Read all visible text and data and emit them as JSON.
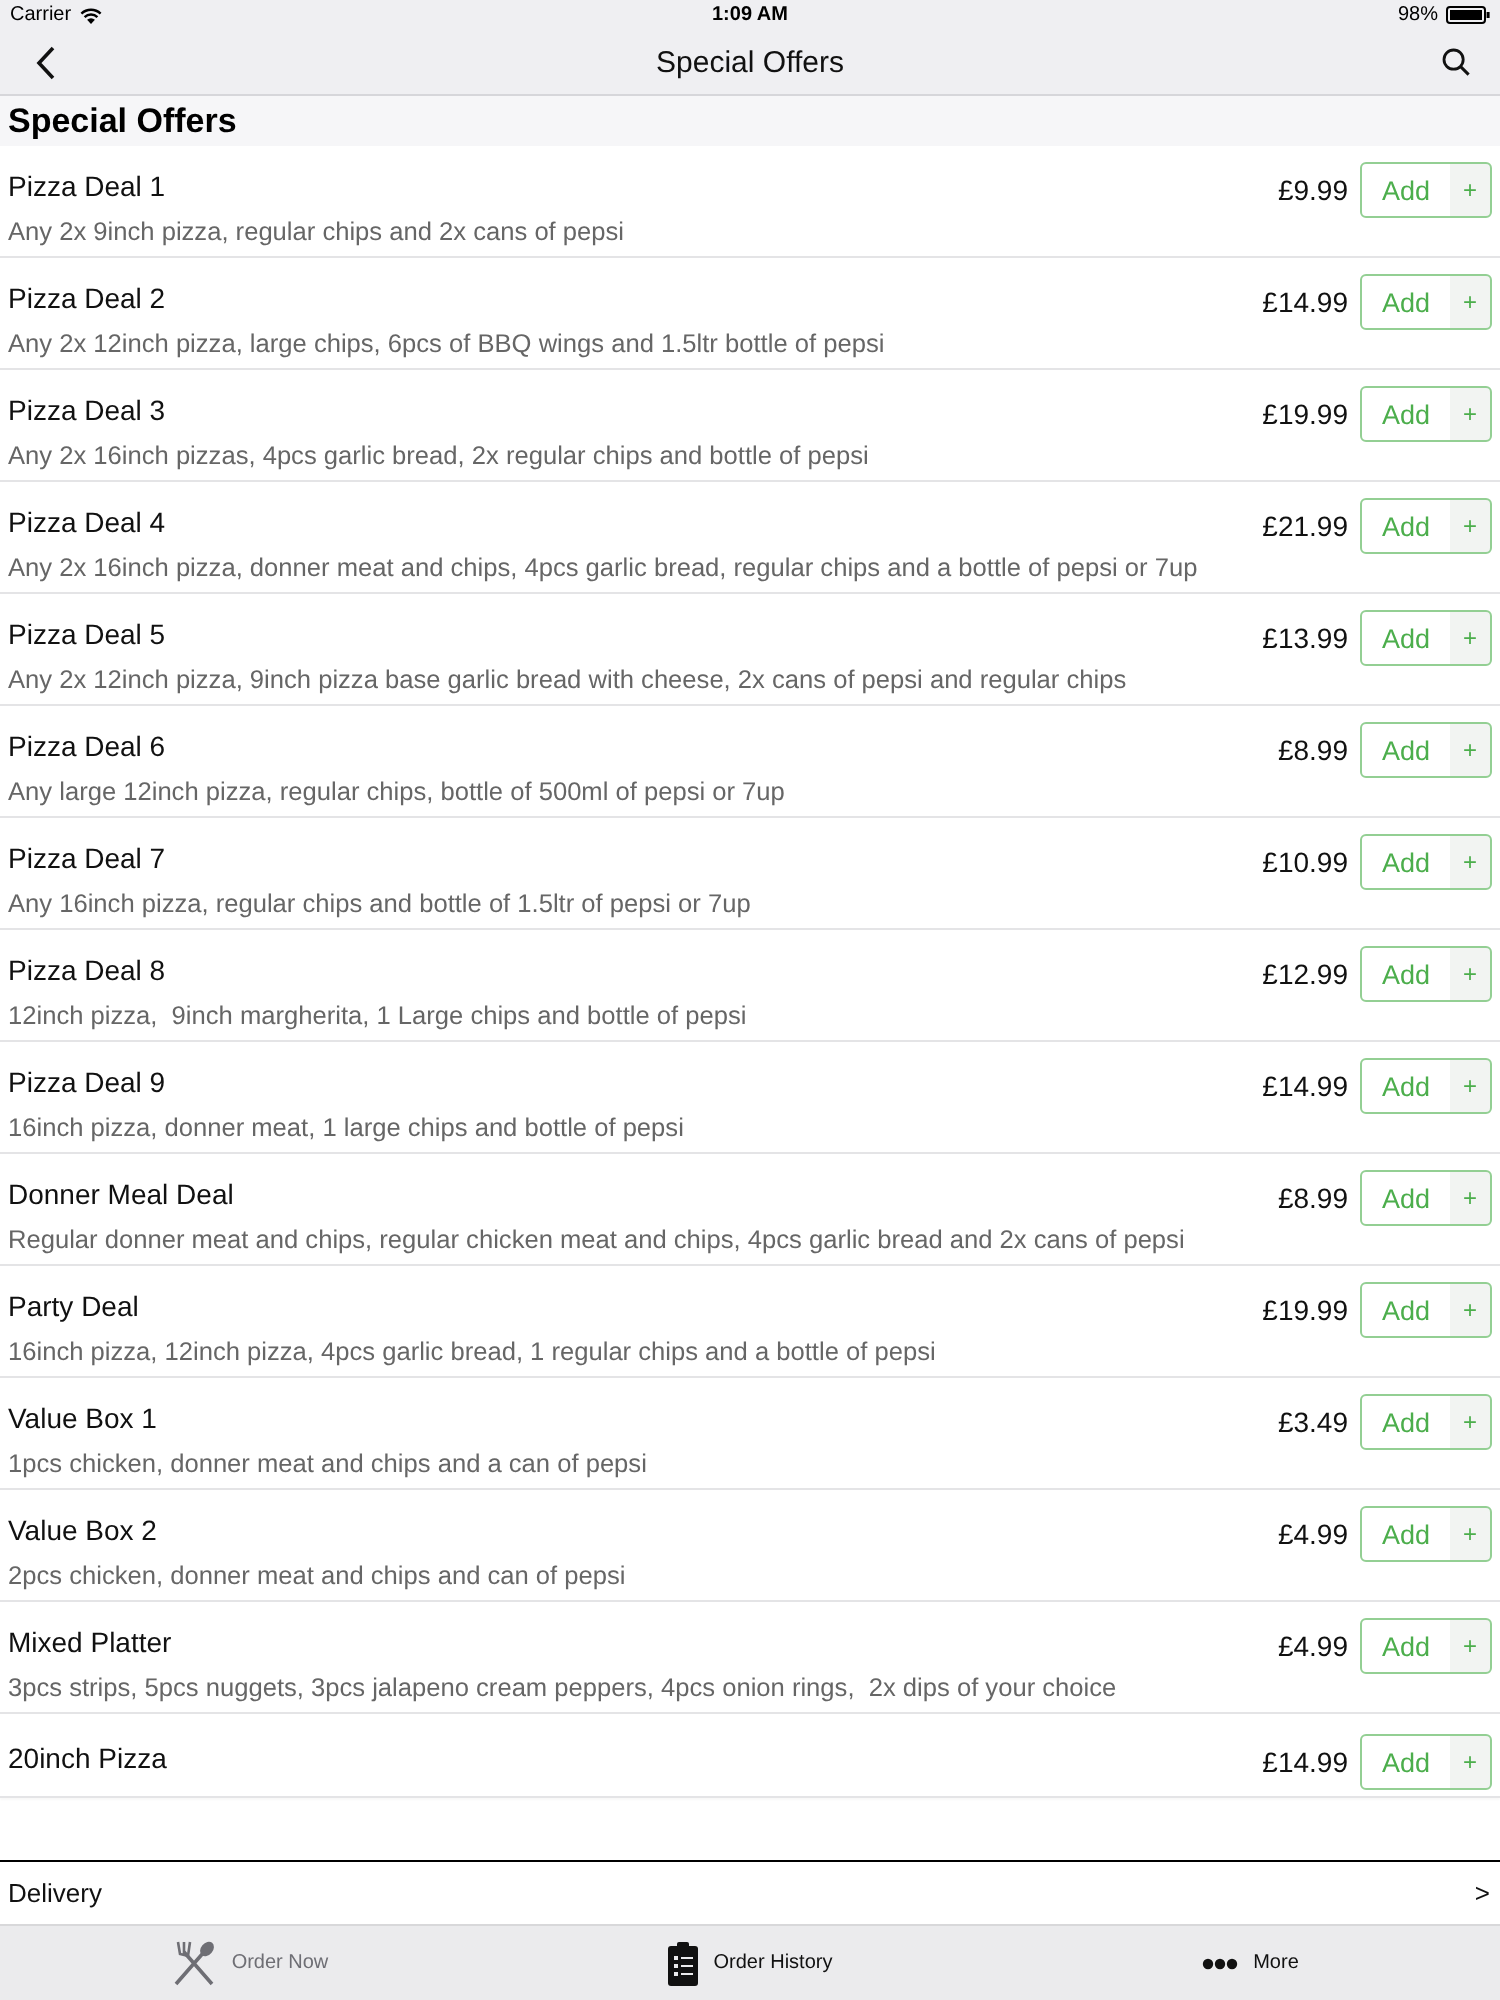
{
  "status_bar": {
    "carrier": "Carrier",
    "time": "1:09 AM",
    "battery": "98%"
  },
  "nav_bar": {
    "title": "Special Offers"
  },
  "section": {
    "title": "Special Offers"
  },
  "items": [
    {
      "name": "Pizza Deal 1",
      "description": "Any 2x 9inch pizza, regular chips and 2x cans of pepsi",
      "price": "£9.99",
      "button": "Add",
      "plus": "+"
    },
    {
      "name": "Pizza Deal 2",
      "description": "Any 2x 12inch pizza, large chips, 6pcs of BBQ wings and 1.5ltr bottle of pepsi",
      "price": "£14.99",
      "button": "Add",
      "plus": "+"
    },
    {
      "name": "Pizza Deal 3",
      "description": "Any 2x 16inch pizzas, 4pcs garlic bread, 2x regular chips and bottle of pepsi",
      "price": "£19.99",
      "button": "Add",
      "plus": "+"
    },
    {
      "name": "Pizza Deal 4",
      "description": "Any 2x 16inch pizza, donner meat and chips, 4pcs garlic bread, regular chips and a bottle of pepsi or 7up",
      "price": "£21.99",
      "button": "Add",
      "plus": "+"
    },
    {
      "name": "Pizza Deal 5",
      "description": "Any 2x 12inch pizza, 9inch pizza base garlic bread with cheese, 2x cans of pepsi and regular chips",
      "price": "£13.99",
      "button": "Add",
      "plus": "+"
    },
    {
      "name": "Pizza Deal 6",
      "description": "Any large 12inch pizza, regular chips, bottle of 500ml of pepsi or 7up",
      "price": "£8.99",
      "button": "Add",
      "plus": "+"
    },
    {
      "name": "Pizza Deal 7",
      "description": "Any 16inch pizza, regular chips and bottle of 1.5ltr of pepsi or 7up",
      "price": "£10.99",
      "button": "Add",
      "plus": "+"
    },
    {
      "name": "Pizza Deal 8",
      "description": "12inch pizza,  9inch margherita, 1 Large chips and bottle of pepsi",
      "price": "£12.99",
      "button": "Add",
      "plus": "+"
    },
    {
      "name": "Pizza Deal 9",
      "description": "16inch pizza, donner meat, 1 large chips and bottle of pepsi",
      "price": "£14.99",
      "button": "Add",
      "plus": "+"
    },
    {
      "name": "Donner Meal Deal",
      "description": "Regular donner meat and chips, regular chicken meat and chips, 4pcs garlic bread and 2x cans of pepsi",
      "price": "£8.99",
      "button": "Add",
      "plus": "+"
    },
    {
      "name": "Party Deal",
      "description": "16inch pizza, 12inch pizza, 4pcs garlic bread, 1 regular chips and a bottle of pepsi",
      "price": "£19.99",
      "button": "Add",
      "plus": "+"
    },
    {
      "name": "Value Box 1",
      "description": "1pcs chicken, donner meat and chips and a can of pepsi",
      "price": "£3.49",
      "button": "Add",
      "plus": "+"
    },
    {
      "name": "Value Box 2",
      "description": "2pcs chicken, donner meat and chips and can of pepsi",
      "price": "£4.99",
      "button": "Add",
      "plus": "+"
    },
    {
      "name": "Mixed Platter",
      "description": "3pcs strips, 5pcs nuggets, 3pcs jalapeno cream peppers, 4pcs onion rings,  2x dips of your choice",
      "price": "£4.99",
      "button": "Add",
      "plus": "+"
    },
    {
      "name": "20inch Pizza",
      "price": "£14.99",
      "button": "Add",
      "plus": "+"
    }
  ],
  "order_type": {
    "label": "Delivery",
    "chevron": ">"
  },
  "tab_bar": [
    {
      "label": "Order Now",
      "selected": true
    },
    {
      "label": "Order History",
      "selected": false
    },
    {
      "label": "More",
      "selected": false
    }
  ]
}
